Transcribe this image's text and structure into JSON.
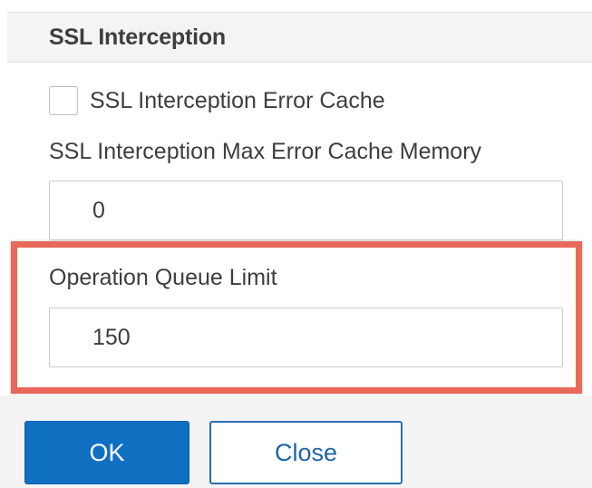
{
  "section": {
    "title": "SSL Interception"
  },
  "error_cache": {
    "label": "SSL Interception Error Cache",
    "checked": false
  },
  "max_error_cache_memory": {
    "label": "SSL Interception Max Error Cache Memory",
    "value": "0"
  },
  "operation_queue_limit": {
    "label": "Operation Queue Limit",
    "value": "150"
  },
  "buttons": {
    "ok_label": "OK",
    "close_label": "Close"
  },
  "colors": {
    "highlight": "#e8685a",
    "primary": "#0f70c2"
  }
}
